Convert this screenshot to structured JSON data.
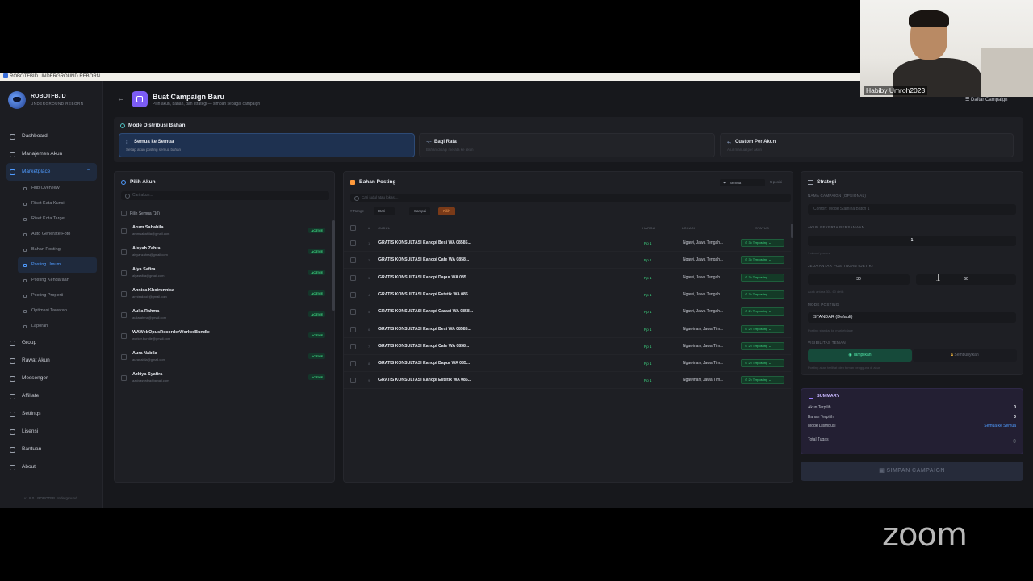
{
  "window": {
    "title": "ROBOTFBID UNDERGROUND REBORN"
  },
  "brand": {
    "title": "ROBOTFB.ID",
    "subtitle": "UNDERGROUND REBORN"
  },
  "sidebar": {
    "items": [
      {
        "label": "Dashboard",
        "icon": "grid-icon"
      },
      {
        "label": "Manajemen Akun",
        "icon": "users-icon"
      },
      {
        "label": "Marketplace",
        "icon": "store-icon",
        "active": true,
        "chevron": "⌃"
      }
    ],
    "subitems": [
      {
        "label": "Hub Overview"
      },
      {
        "label": "Riset Kata Kunci"
      },
      {
        "label": "Riset Kota Target"
      },
      {
        "label": "Auto Generate Foto"
      },
      {
        "label": "Bahan Posting"
      },
      {
        "label": "Posting Umum",
        "active": true
      },
      {
        "label": "Posting Kendaraan"
      },
      {
        "label": "Posting Properti"
      },
      {
        "label": "Optimasi Tawaran"
      },
      {
        "label": "Laporan"
      }
    ],
    "items_bottom": [
      {
        "label": "Group",
        "icon": "group-icon"
      },
      {
        "label": "Rawat Akun",
        "icon": "heart-icon"
      },
      {
        "label": "Messenger",
        "icon": "chat-icon"
      },
      {
        "label": "Affiliate",
        "icon": "share-icon"
      },
      {
        "label": "Settings",
        "icon": "gear-icon"
      },
      {
        "label": "Lisensi",
        "icon": "key-icon"
      },
      {
        "label": "Bantuan",
        "icon": "help-icon"
      },
      {
        "label": "About",
        "icon": "info-icon"
      }
    ],
    "version": "v1.8.0 · ROBOTFB Underground"
  },
  "header": {
    "back": "←",
    "title": "Buat Campaign Baru",
    "subtitle": "Pilih akun, bahan, dan strategi — simpan sebagai campaign",
    "list_button": "Daftar Campaign"
  },
  "mode": {
    "title": "Mode Distribusi Bahan",
    "options": [
      {
        "icon": "⁞⁞",
        "label": "Semua ke Semua",
        "desc": "Setiap akun posting semua bahan",
        "selected": true
      },
      {
        "icon": "⌥",
        "label": "Bagi Rata",
        "desc": "Bahan dibagi merata ke akun",
        "selected": false
      },
      {
        "icon": "⇆",
        "label": "Custom Per Akun",
        "desc": "Atur manual per akun",
        "selected": false
      }
    ]
  },
  "accounts": {
    "title": "Pilih Akun",
    "search_placeholder": "Cari akun...",
    "select_all": "Pilih Semua (10)",
    "list": [
      {
        "name": "Arum Sabahila",
        "email": "arumsabahila@gmail.com",
        "status": "ACTIVE"
      },
      {
        "name": "Aisyah Zahra",
        "email": "aisyahzahra@gmail.com",
        "status": "ACTIVE"
      },
      {
        "name": "Alya Safira",
        "email": "alyasafira@gmail.com",
        "status": "ACTIVE"
      },
      {
        "name": "Annisa Khoirunnisa",
        "email": "annisakhoir@gmail.com",
        "status": "ACTIVE"
      },
      {
        "name": "Aulia Rahma",
        "email": "auliarahma@gmail.com",
        "status": "ACTIVE"
      },
      {
        "name": "WAWebOpusRecorderWorkerBundle",
        "email": "worker.bundle@gmail.com",
        "status": "ACTIVE"
      },
      {
        "name": "Aura Nabila",
        "email": "auranabila@gmail.com",
        "status": "ACTIVE"
      },
      {
        "name": "Azkiya Syafira",
        "email": "azkiyasyafira@gmail.com",
        "status": "ACTIVE"
      }
    ]
  },
  "posting": {
    "title": "Bahan Posting",
    "filter": "Semua",
    "count": "5 posisi",
    "search_placeholder": "Cari judul atau lokasi...",
    "range": {
      "label": "Range",
      "from": "Dari",
      "sep": "—",
      "to": "Sampai",
      "button": "Pilih"
    },
    "columns": {
      "no": "#",
      "title": "JUDUL",
      "price": "HARGA",
      "location": "LOKASI",
      "status": "STATUS"
    },
    "rows": [
      {
        "no": "1",
        "title": "GRATIS KONSULTASI Kanopi Besi WA 08585...",
        "price": "Rp 1",
        "location": "Ngawi, Jawa Tengah...",
        "status": "3x Terposting"
      },
      {
        "no": "2",
        "title": "GRATIS KONSULTASI Kanopi Cafe WA 0858...",
        "price": "Rp 1",
        "location": "Ngawi, Jawa Tengah...",
        "status": "3x Terposting"
      },
      {
        "no": "3",
        "title": "GRATIS KONSULTASI Kanopi Dapur WA 085...",
        "price": "Rp 1",
        "location": "Ngawi, Jawa Tengah...",
        "status": "3x Terposting"
      },
      {
        "no": "4",
        "title": "GRATIS KONSULTASI Kanopi Estetik WA 085...",
        "price": "Rp 1",
        "location": "Ngawi, Jawa Tengah...",
        "status": "3x Terposting"
      },
      {
        "no": "5",
        "title": "GRATIS KONSULTASI Kanopi Garasi WA 0858...",
        "price": "Rp 1",
        "location": "Ngawi, Jawa Tengah...",
        "status": "2x Terposting"
      },
      {
        "no": "6",
        "title": "GRATIS KONSULTASI Kanopi Besi WA 08585...",
        "price": "Rp 1",
        "location": "Ngawinan, Jawa Tim...",
        "status": "2x Terposting"
      },
      {
        "no": "7",
        "title": "GRATIS KONSULTASI Kanopi Cafe WA 0858...",
        "price": "Rp 1",
        "location": "Ngawinan, Jawa Tim...",
        "status": "2x Terposting"
      },
      {
        "no": "8",
        "title": "GRATIS KONSULTASI Kanopi Dapur WA 085...",
        "price": "Rp 1",
        "location": "Ngawinan, Jawa Tim...",
        "status": "2x Terposting"
      },
      {
        "no": "9",
        "title": "GRATIS KONSULTASI Kanopi Estetik WA 085...",
        "price": "Rp 1",
        "location": "Ngawinan, Jawa Tim...",
        "status": "2x Terposting"
      }
    ]
  },
  "strategy": {
    "title": "Strategi",
    "name_label": "NAMA CAMPAIGN (OPSIONAL)",
    "name_placeholder": "Contoh: Mode Stamina Batch 1",
    "parallel_label": "AKUN BEKERJA BERSAMAAN",
    "parallel_value": "1",
    "parallel_hint": "1 akun / proses",
    "delay_label": "JEDA ANTAR POSTINGAN (DETIK)",
    "delay_min": "30",
    "delay_max": "60",
    "delay_hint": "Acak antara 30 - 60 detik",
    "mode_label": "MODE POSTING",
    "mode_value": "STANDAR (Default)",
    "mode_hint": "Posting standar ke marketplace",
    "visibility_label": "VISIBILITAS TEMAN",
    "show_label": "Tampilkan",
    "hide_label": "Sembunyikan",
    "visibility_hint": "Posting akan terlihat oleh teman pengguna di akun"
  },
  "summary": {
    "title": "SUMMARY",
    "rows": [
      {
        "key": "Akun Terpilih",
        "value": "0"
      },
      {
        "key": "Bahan Terpilih",
        "value": "0"
      },
      {
        "key": "Mode Distribusi",
        "value": "Semua ke Semua"
      },
      {
        "key": "Total Tugas",
        "value": "0"
      }
    ]
  },
  "save_button": "SIMPAN CAMPAIGN",
  "zoom": {
    "participant_name": "Habiby Umroh2023",
    "logo": "zoom"
  },
  "colors": {
    "accent": "#4f9bff",
    "active_green": "#3ddc84",
    "range_button": "#ffa75c",
    "summary": "#c9b8ff"
  }
}
